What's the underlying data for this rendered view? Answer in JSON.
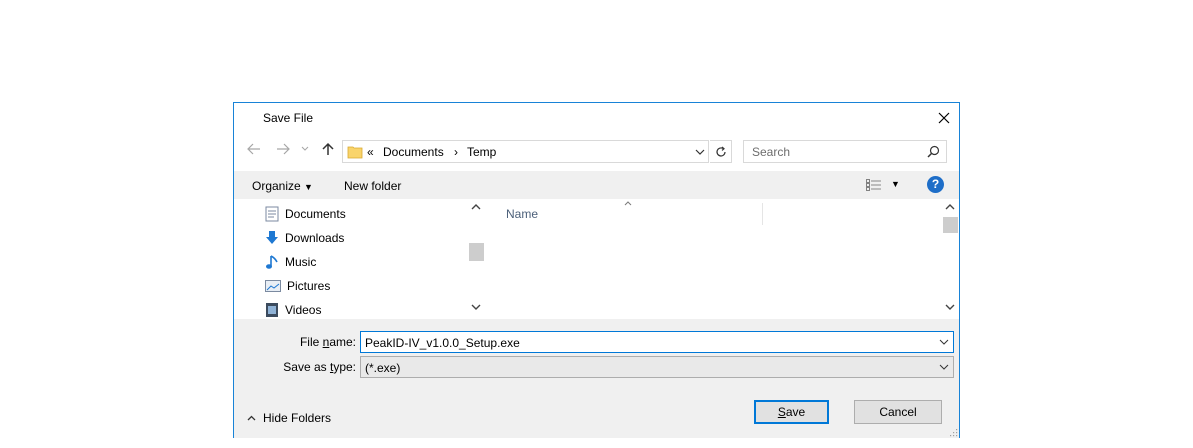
{
  "dialog": {
    "title": "Save File"
  },
  "nav": {
    "back": "back",
    "forward": "forward",
    "recent": "recent-locations",
    "up": "up"
  },
  "address": {
    "overflow": "«",
    "crumbs": [
      "Documents",
      "Temp"
    ],
    "separator": "›"
  },
  "search": {
    "placeholder": "Search"
  },
  "toolbar": {
    "organize_label": "Organize",
    "new_folder_label": "New folder",
    "help": "?"
  },
  "sidebar": {
    "items": [
      {
        "label": "Documents",
        "icon": "documents-icon"
      },
      {
        "label": "Downloads",
        "icon": "downloads-icon"
      },
      {
        "label": "Music",
        "icon": "music-icon"
      },
      {
        "label": "Pictures",
        "icon": "pictures-icon"
      },
      {
        "label": "Videos",
        "icon": "videos-icon"
      }
    ]
  },
  "filelist": {
    "columns": [
      "Name"
    ]
  },
  "form": {
    "filename_label_pre": "File ",
    "filename_label_u": "n",
    "filename_label_post": "ame:",
    "filename_value": "PeakID-IV_v1.0.0_Setup.exe",
    "savetype_label_pre": "Save as ",
    "savetype_label_u": "t",
    "savetype_label_post": "ype:",
    "savetype_value": "(*.exe)"
  },
  "footer": {
    "hide_folders_label": "Hide Folders",
    "save_label_u": "S",
    "save_label_post": "ave",
    "cancel_label": "Cancel"
  },
  "colors": {
    "accent": "#1883d7",
    "focus": "#0078d7",
    "toolbar_bg": "#f0f0f0",
    "help": "#1e6ec8"
  }
}
